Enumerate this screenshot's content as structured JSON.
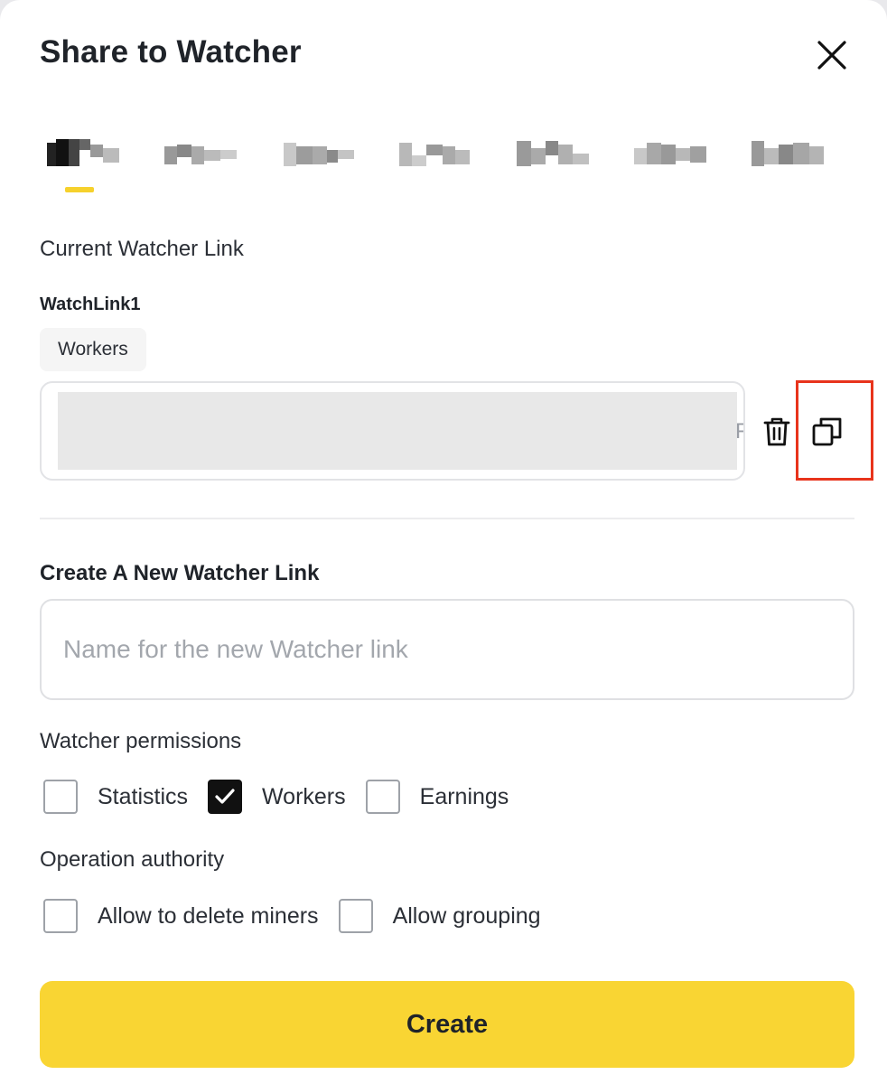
{
  "dialog": {
    "title": "Share to Watcher",
    "close_icon": "close-icon"
  },
  "coin_tabs": {
    "active_index": 0,
    "accent_color": "#f6d12c",
    "count": 7
  },
  "current_link": {
    "section_label": "Current Watcher Link",
    "name": "WatchLink1",
    "permission_chip": "Workers",
    "url_tail": "F",
    "delete_icon": "trash-icon",
    "copy_icon": "copy-icon",
    "highlight_color": "#e8341c"
  },
  "new_link": {
    "section_title": "Create A New Watcher Link",
    "name_placeholder": "Name for the new Watcher link",
    "name_value": "",
    "permissions_label": "Watcher permissions",
    "permissions": [
      {
        "label": "Statistics",
        "checked": false
      },
      {
        "label": "Workers",
        "checked": true
      },
      {
        "label": "Earnings",
        "checked": false
      }
    ],
    "authority_label": "Operation authority",
    "authority": [
      {
        "label": "Allow to delete miners",
        "checked": false
      },
      {
        "label": "Allow grouping",
        "checked": false
      }
    ],
    "create_label": "Create",
    "button_color": "#f9d533"
  }
}
